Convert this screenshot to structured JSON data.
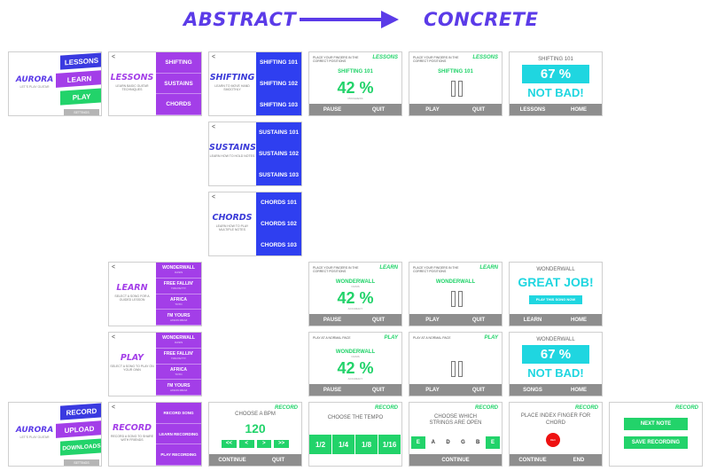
{
  "header": {
    "abstract": "ABSTRACT",
    "concrete": "CONCRETE"
  },
  "home": {
    "brand": "AURORA",
    "subtitle": "LET'S PLAY GUITAR",
    "tabs": [
      "LESSONS",
      "LEARN",
      "PLAY"
    ],
    "footer": "SETTINGS"
  },
  "home_record": {
    "brand": "AURORA",
    "subtitle": "LET'S PLAY GUITAR",
    "tabs": [
      "RECORD",
      "UPLOAD",
      "DOWNLOADS"
    ],
    "footer": "SETTINGS"
  },
  "lessons": {
    "title": "LESSONS",
    "subtitle": "LEARN BASIC GUITAR TECHNIQUES",
    "items": [
      "SHIFTING",
      "SUSTAINS",
      "CHORDS"
    ]
  },
  "shifting": {
    "title": "SHIFTING",
    "subtitle": "LEARN TO MOVE HAND SMOOTHLY",
    "items": [
      "SHIFTING 101",
      "SHIFTING 102",
      "SHIFTING 103"
    ]
  },
  "sustains": {
    "title": "SUSTAINS",
    "subtitle": "LEARN HOW TO HOLD NOTES",
    "items": [
      "SUSTAINS 101",
      "SUSTAINS 102",
      "SUSTAINS 103"
    ]
  },
  "chords": {
    "title": "CHORDS",
    "subtitle": "LEARN HOW TO PLAY MULTIPLE NOTES",
    "items": [
      "CHORDS 101",
      "CHORDS 102",
      "CHORDS 103"
    ]
  },
  "learn": {
    "title": "LEARN",
    "subtitle": "SELECT A SONG FOR A GUIDED LESSON",
    "songs": [
      {
        "name": "WONDERWALL",
        "artist": "OASIS"
      },
      {
        "name": "FREE FALLIN'",
        "artist": "TOM PETTY"
      },
      {
        "name": "AFRICA",
        "artist": "TOTO"
      },
      {
        "name": "I'M YOURS",
        "artist": "JASON MRAZ"
      }
    ]
  },
  "play": {
    "title": "PLAY",
    "subtitle": "SELECT A SONG TO PLAY ON YOUR OWN",
    "songs": [
      {
        "name": "WONDERWALL",
        "artist": "OASIS"
      },
      {
        "name": "FREE FALLIN'",
        "artist": "TOM PETTY"
      },
      {
        "name": "AFRICA",
        "artist": "TOTO"
      },
      {
        "name": "I'M YOURS",
        "artist": "JASON MRAZ"
      }
    ]
  },
  "record": {
    "title": "RECORD",
    "subtitle": "RECORD A SONG TO SHARE WITH FRIENDS",
    "items": [
      "RECORD SONG",
      "LEARN RECORDING",
      "PLAY RECORDING"
    ]
  },
  "lesson_active": {
    "instruction": "PLACE YOUR FINGERS IN THE CORRECT POSITIONS",
    "tag": "LESSONS",
    "song": "SHIFTING 101",
    "sub": "PROGRESS",
    "percent": "42 %",
    "buttons": [
      "PAUSE",
      "QUIT"
    ]
  },
  "lesson_paused": {
    "instruction": "PLACE YOUR FINGERS IN THE CORRECT POSITIONS",
    "tag": "LESSONS",
    "song": "SHIFTING 101",
    "buttons": [
      "PLAY",
      "QUIT"
    ]
  },
  "lesson_result": {
    "caption": "SHIFTING 101",
    "score": "67 %",
    "message": "NOT BAD!",
    "buttons": [
      "LESSONS",
      "HOME"
    ]
  },
  "learn_active": {
    "instruction": "PLACE YOUR FINGERS IN THE CORRECT POSITIONS",
    "tag": "LEARN",
    "song": "WONDERWALL",
    "artist": "OASIS",
    "sub": "ACCURACY",
    "percent": "42 %",
    "buttons": [
      "PAUSE",
      "QUIT"
    ]
  },
  "learn_paused": {
    "instruction": "PLACE YOUR FINGERS IN THE CORRECT POSITIONS",
    "tag": "LEARN",
    "song": "WONDERWALL",
    "buttons": [
      "PLAY",
      "QUIT"
    ]
  },
  "learn_result": {
    "caption": "WONDERWALL",
    "message": "GREAT JOB!",
    "cta": "PLAY THIS SONG NOW",
    "buttons": [
      "LEARN",
      "HOME"
    ]
  },
  "play_active": {
    "instruction": "PLAY AT A NORMAL PACE",
    "tag": "PLAY",
    "song": "WONDERWALL",
    "artist": "OASIS",
    "sub": "ACCURACY",
    "percent": "42 %",
    "buttons": [
      "PAUSE",
      "QUIT"
    ]
  },
  "play_paused": {
    "instruction": "PLAY AT A NORMAL PACE",
    "tag": "PLAY",
    "buttons": [
      "PLAY",
      "QUIT"
    ]
  },
  "play_result": {
    "song": "WONDERWALL",
    "score": "67 %",
    "message": "NOT BAD!",
    "buttons": [
      "SONGS",
      "HOME"
    ]
  },
  "bpm": {
    "tag": "RECORD",
    "label": "CHOOSE A BPM",
    "value": "120",
    "nav": [
      "<<",
      "<",
      ">",
      ">>"
    ],
    "buttons": [
      "CONTINUE",
      "QUIT"
    ]
  },
  "tempo": {
    "tag": "RECORD",
    "label": "CHOOSE THE TEMPO",
    "options": [
      "1/2",
      "1/4",
      "1/8",
      "1/16"
    ]
  },
  "strings": {
    "tag": "RECORD",
    "label": "CHOOSE WHICH STRINGS ARE OPEN",
    "strings": [
      "E",
      "A",
      "D",
      "G",
      "B",
      "E"
    ],
    "open": [
      true,
      false,
      false,
      false,
      false,
      true
    ],
    "button": "CONTINUE"
  },
  "chord_place": {
    "tag": "RECORD",
    "label": "PLACE INDEX FINGER FOR CHORD",
    "rec": "REC",
    "buttons": [
      "CONTINUE",
      "END"
    ]
  },
  "save": {
    "tag": "RECORD",
    "buttons": [
      "NEXT NOTE",
      "SAVE RECORDING"
    ]
  }
}
